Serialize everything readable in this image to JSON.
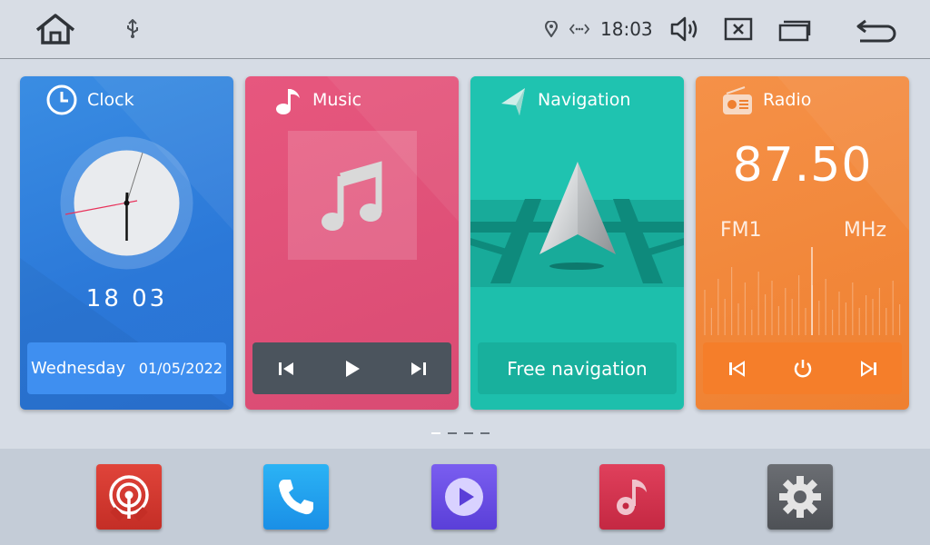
{
  "statusbar": {
    "time": "18:03",
    "icons": [
      "home-icon",
      "usb-icon",
      "location-icon",
      "wireless-icon",
      "volume-icon",
      "close-window-icon",
      "recent-apps-icon",
      "back-icon"
    ]
  },
  "cards": {
    "clock": {
      "title": "Clock",
      "time_display": "18 03",
      "day": "Wednesday",
      "date": "01/05/2022",
      "icon": "clock-icon"
    },
    "music": {
      "title": "Music",
      "icon": "music-note-icon",
      "controls": [
        "previous-icon",
        "play-icon",
        "next-icon"
      ]
    },
    "navigation": {
      "title": "Navigation",
      "icon": "navigation-arrow-icon",
      "button_label": "Free navigation"
    },
    "radio": {
      "title": "Radio",
      "icon": "radio-icon",
      "frequency": "87.50",
      "band": "FM1",
      "unit": "MHz",
      "controls": [
        "previous-icon",
        "power-icon",
        "next-icon"
      ]
    }
  },
  "pager": {
    "count": 4,
    "active_index": 0
  },
  "dock": {
    "apps": [
      {
        "name": "radio-app",
        "icon": "broadcast-icon",
        "color": "#d9392c"
      },
      {
        "name": "phone-app",
        "icon": "phone-icon",
        "color": "#1fa3ef"
      },
      {
        "name": "video-app",
        "icon": "video-play-icon",
        "color": "#6a4fe0"
      },
      {
        "name": "music-app",
        "icon": "music-note-icon",
        "color": "#d8304e"
      },
      {
        "name": "settings-app",
        "icon": "gear-icon",
        "color": "#5e6166"
      }
    ]
  },
  "colors": {
    "clock_card": "#3a8de3",
    "music_card": "#e7577e",
    "navigation_card": "#1dbfac",
    "radio_card": "#f59148",
    "status_bar": "#d8dde5"
  }
}
